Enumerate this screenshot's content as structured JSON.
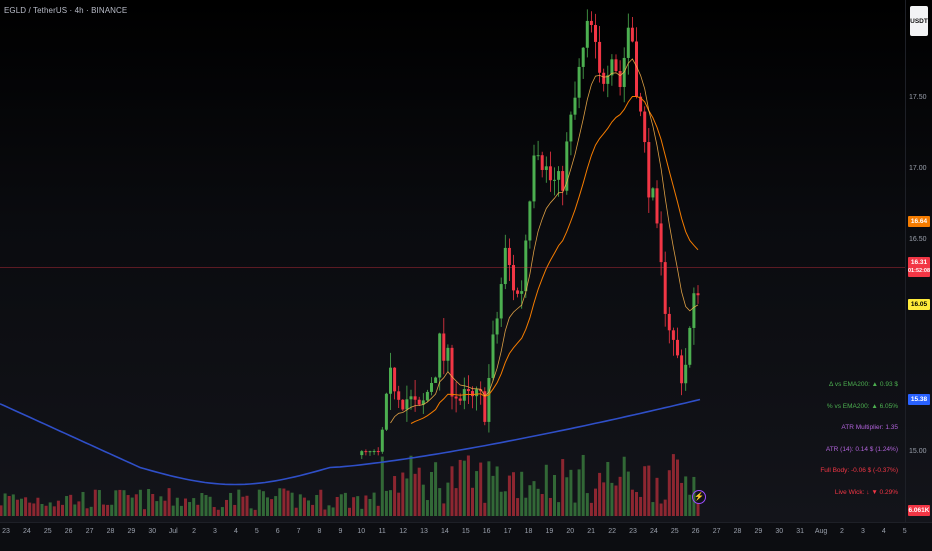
{
  "header": {
    "title": "EGLD / TetherUS · 4h · BINANCE"
  },
  "axis": {
    "currency_button": "USDT",
    "price_ticks": [
      {
        "p": 17.5,
        "label": "17.50"
      },
      {
        "p": 17.0,
        "label": "17.00"
      },
      {
        "p": 16.5,
        "label": "16.50"
      },
      {
        "p": 15.0,
        "label": "15.00"
      }
    ],
    "tags": [
      {
        "label": "16.64",
        "sub": "",
        "color": "#f57c00",
        "text": "#fff",
        "p": 16.64
      },
      {
        "label": "16.31",
        "sub": "01:52:08",
        "color": "#f23645",
        "text": "#fff",
        "p": 16.31
      },
      {
        "label": "16.05",
        "sub": "",
        "color": "#ffeb3b",
        "text": "#000",
        "p": 16.05
      },
      {
        "label": "15.38",
        "sub": "",
        "color": "#2962ff",
        "text": "#fff",
        "p": 15.38
      },
      {
        "label": "6.061K",
        "sub": "",
        "color": "#f23645",
        "text": "#fff",
        "p": 14.6
      }
    ],
    "time_ticks": [
      "23",
      "24",
      "25",
      "26",
      "27",
      "28",
      "29",
      "30",
      "Jul",
      "2",
      "3",
      "4",
      "5",
      "6",
      "7",
      "8",
      "9",
      "10",
      "11",
      "12",
      "13",
      "14",
      "15",
      "16",
      "17",
      "18",
      "19",
      "20",
      "21",
      "22",
      "23",
      "24",
      "25",
      "26",
      "27",
      "28",
      "29",
      "30",
      "31",
      "Aug",
      "2",
      "3",
      "4",
      "5"
    ]
  },
  "info_panel": [
    {
      "text": "Δ vs EMA200: ▲ 0.93 $",
      "color": "#4caf50"
    },
    {
      "text": "% vs EMA200: ▲ 6.05%",
      "color": "#4caf50"
    },
    {
      "text": "ATR Multiplier: 1.35",
      "color": "#b062d9"
    },
    {
      "text": "ATR (14): 0.14 $ (1.24%)",
      "color": "#b062d9"
    },
    {
      "text": "Full Body: -0.06 $ (-0.37%)",
      "color": "#f23645"
    },
    {
      "text": "Live Wick: ↓ ▼ 0.29%",
      "color": "#f23645"
    }
  ],
  "chart_data": {
    "type": "candlestick",
    "symbol": "EGLD / TetherUS",
    "interval": "4h",
    "exchange": "BINANCE",
    "ylim": [
      14.6,
      18.2
    ],
    "last_price": 16.31,
    "countdown": "01:52:08",
    "ema_slow_last": 16.64,
    "ema_fast_last": 16.05,
    "ema200_last": 15.38,
    "volume_last": "6.061K",
    "colors": {
      "up": "#4caf50",
      "down": "#f23645",
      "ema_fast": "#ffb74d",
      "ema_slow": "#f57c00",
      "ema200": "#2f4fc8"
    }
  }
}
